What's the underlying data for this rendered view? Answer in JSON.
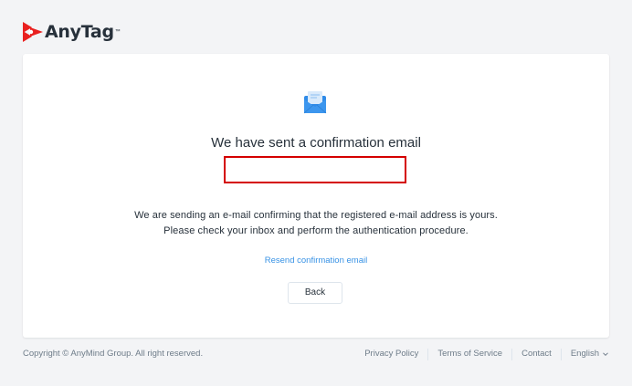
{
  "brand": {
    "name": "AnyTag",
    "trademark": "™",
    "colors": {
      "mark_primary": "#e9201f",
      "mark_accent": "#ff5c3c"
    }
  },
  "card": {
    "icon": "mail-icon",
    "title": "We have sent a confirmation email",
    "email_value": "",
    "description_line1": "We are sending an e-mail confirming that the registered e-mail address is yours.",
    "description_line2": "Please check your inbox and perform the authentication procedure.",
    "resend_label": "Resend confirmation email",
    "back_label": "Back"
  },
  "footer": {
    "copyright": "Copyright © AnyMind Group. All right reserved.",
    "links": {
      "privacy": "Privacy Policy",
      "terms": "Terms of Service",
      "contact": "Contact"
    },
    "language": "English"
  },
  "colors": {
    "link": "#3892e5",
    "highlight_box": "#d40000",
    "text": "#27313b",
    "muted": "#6e7c89",
    "background": "#f3f4f6"
  }
}
